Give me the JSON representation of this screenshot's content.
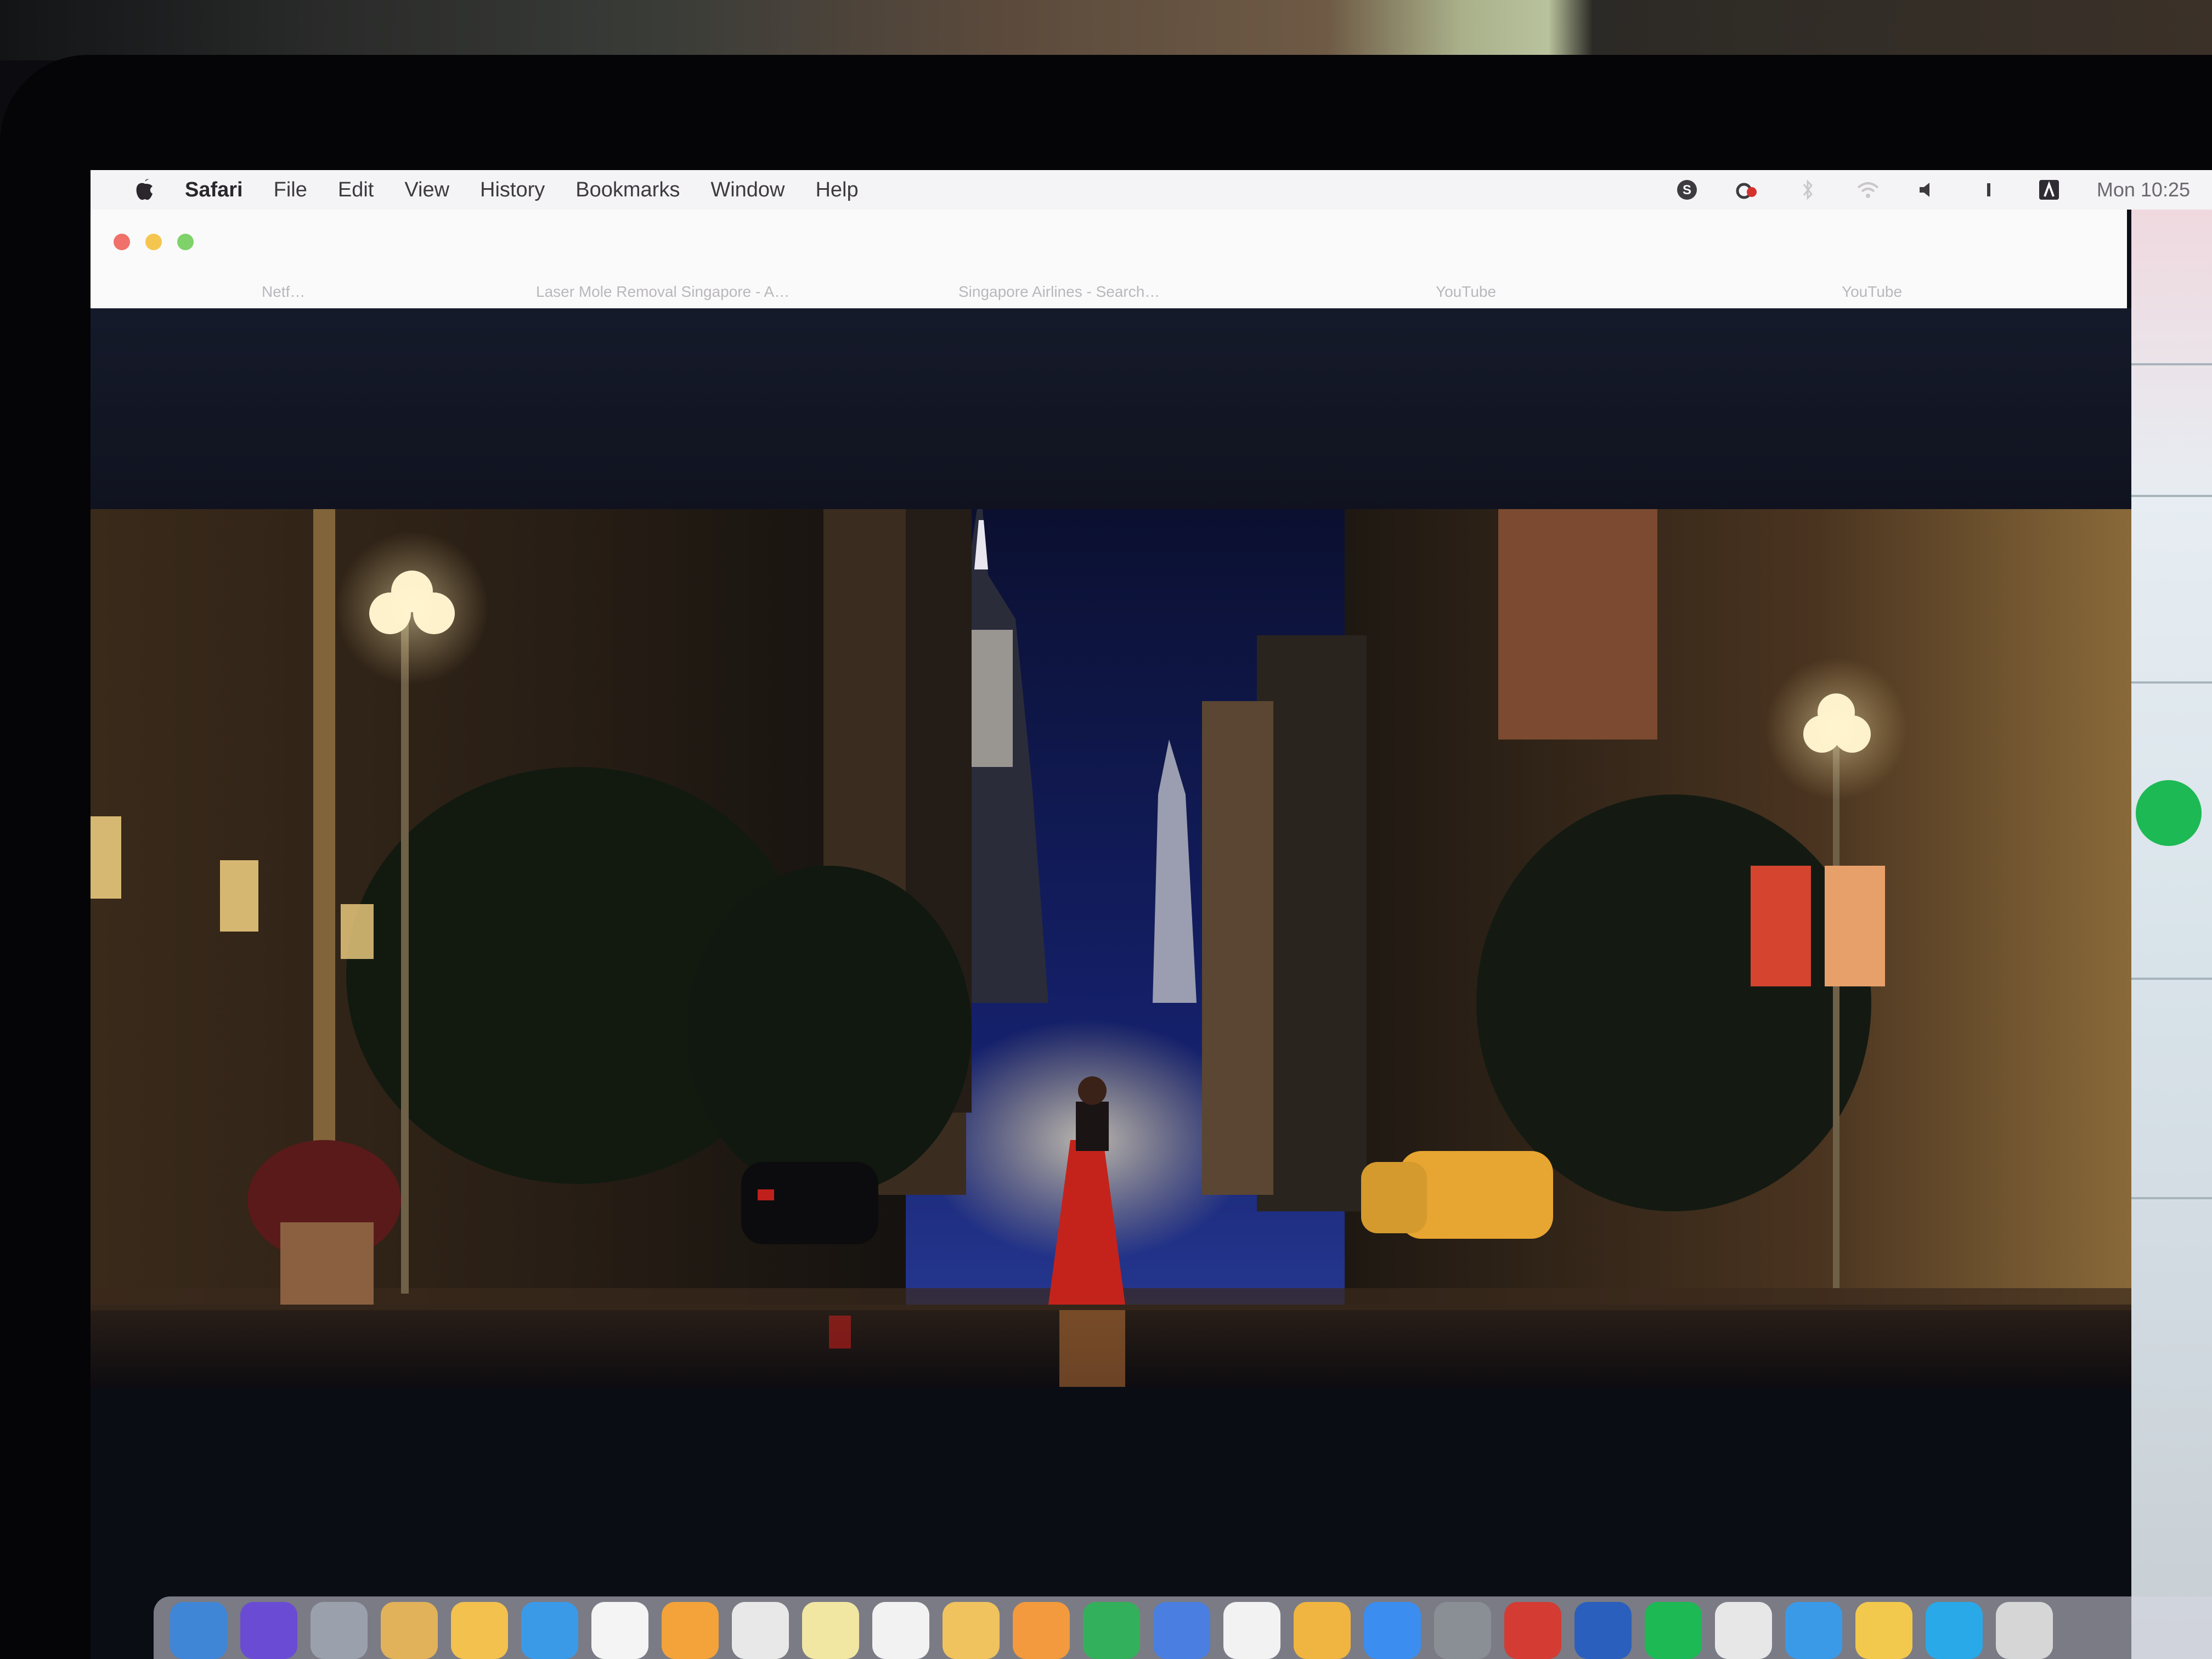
{
  "menubar": {
    "app_name": "Safari",
    "items": [
      "File",
      "Edit",
      "View",
      "History",
      "Bookmarks",
      "Window",
      "Help"
    ],
    "status_icons": [
      "skype-icon",
      "creative-cloud-icon",
      "bluetooth-icon",
      "wifi-icon",
      "volume-icon",
      "battery-icon",
      "user-icon"
    ],
    "clock": "Mon 10:25"
  },
  "safari": {
    "tabs": [
      "Netf…",
      "Laser Mole Removal Singapore - A…",
      "Singapore Airlines - Search…",
      "YouTube",
      "YouTube"
    ]
  },
  "dock": {
    "icons": [
      "finder-icon",
      "siri-icon",
      "launchpad-icon",
      "preview-icon",
      "notes-icon",
      "safari-icon",
      "calendar-icon",
      "pages-icon",
      "textedit-icon",
      "stickies-icon",
      "photos-icon",
      "folder-icon",
      "books-icon",
      "numbers-icon",
      "keynote-icon",
      "messages-icon",
      "ibooks-icon",
      "app-store-icon",
      "system-preferences-icon",
      "photo-booth-icon",
      "word-icon",
      "spotify-icon",
      "preview-doc-icon",
      "safari-dock-icon",
      "chrome-icon",
      "skype-dock-icon",
      "trash-icon"
    ],
    "colors": [
      "#3f86d6",
      "#6a4cd4",
      "#9aa1ad",
      "#e1b25a",
      "#f2c14e",
      "#3a9ae8",
      "#f4f4f4",
      "#f3a33a",
      "#e8e8e8",
      "#f1e7a2",
      "#f2f2f2",
      "#f0c35e",
      "#f29a3d",
      "#33b05b",
      "#4a7ee0",
      "#f2f2f2",
      "#f0b540",
      "#3b8df0",
      "#8a8f96",
      "#d33b33",
      "#2b5fbd",
      "#1db954",
      "#e7e7e7",
      "#3a9ae8",
      "#f2c94c",
      "#29a9e8",
      "#d6d6d6"
    ]
  },
  "colors": {
    "menubar_bg": "#f4f3f6",
    "sky": "#14206a",
    "street_light": "#f7d98a",
    "taxi": "#e7a531",
    "dress": "#c4231b",
    "banner": "#d4442f"
  }
}
